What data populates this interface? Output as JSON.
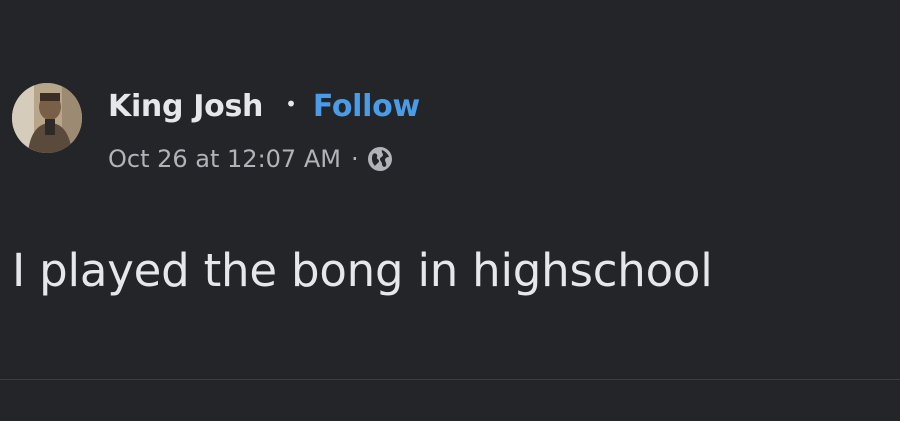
{
  "post": {
    "author": {
      "name": "King Josh",
      "separator": "•",
      "follow_label": "Follow"
    },
    "meta": {
      "timestamp": "Oct 26 at 12:07 AM",
      "separator": "·",
      "audience_icon": "globe-icon"
    },
    "text": "I played the bong in highschool"
  },
  "colors": {
    "background": "#232528",
    "text_primary": "#e6e7ea",
    "text_secondary": "#b0b3b8",
    "link": "#4b9ce8"
  }
}
